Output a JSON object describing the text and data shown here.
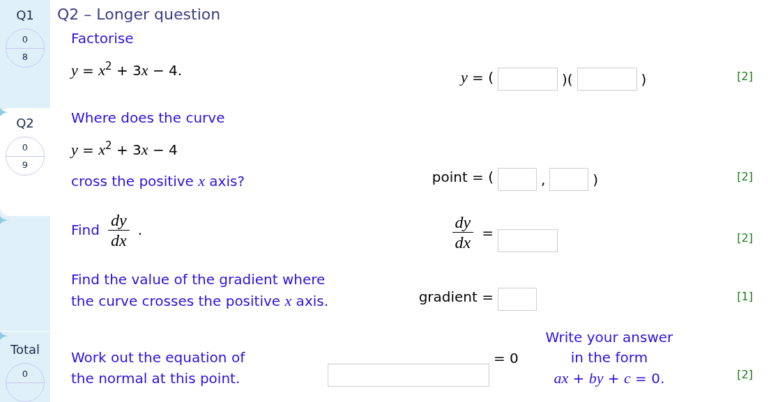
{
  "sidebar": {
    "items": [
      {
        "label": "Q1",
        "score": "0",
        "max": "8",
        "selected": false
      },
      {
        "label": "Q2",
        "score": "0",
        "max": "9",
        "selected": true
      }
    ],
    "total": {
      "label": "Total",
      "score": "0"
    }
  },
  "question": {
    "title": "Q2 – Longer question",
    "parts": [
      {
        "prompt": [
          [
            {
              "kind": "text",
              "text": "Factorise"
            }
          ],
          [
            {
              "kind": "math",
              "segments": [
                "*y* = *x*$^{2}$ + 3",
                "*x* − 4."
              ]
            }
          ]
        ],
        "answer_lhs": [
          {
            "kind": "math",
            "text": "*y* = ("
          }
        ],
        "answer_rhs": [
          {
            "kind": "field"
          },
          {
            "kind": "math",
            "text": ")("
          },
          {
            "kind": "field"
          },
          {
            "kind": "math",
            "text": ")"
          }
        ],
        "marks": "[2]"
      },
      {
        "prompt": [
          [
            {
              "kind": "text",
              "text": "Where does the curve"
            }
          ],
          [
            {
              "kind": "math",
              "segments": [
                "*y* = *x*$^{2}$ + 3",
                "*x* − 4"
              ]
            }
          ],
          [
            {
              "kind": "text",
              "text": "cross the positive *x* axis?"
            }
          ]
        ],
        "answer_lhs": [
          {
            "kind": "math",
            "text": "point = ("
          }
        ],
        "answer_rhs": [
          {
            "kind": "short_field"
          },
          {
            "kind": "math",
            "text": ","
          },
          {
            "kind": "short_field"
          },
          {
            "kind": "math",
            "text": ")"
          }
        ],
        "marks": "[2]"
      },
      {
        "prompt": [
          [
            {
              "kind": "text",
              "text": "Find"
            },
            {
              "kind": "frac",
              "num": "dy",
              "den": "dx"
            },
            {
              "kind": "math",
              "text": "."
            }
          ]
        ],
        "answer_lhs": [
          {
            "kind": "frac",
            "num": "dy",
            "den": "dx"
          },
          {
            "kind": "math",
            "text": "="
          }
        ],
        "answer_rhs": [
          {
            "kind": "field"
          }
        ],
        "marks": "[2]"
      },
      {
        "prompt": [
          [
            {
              "kind": "text",
              "text": "Find the value of the gradient where"
            }
          ],
          [
            {
              "kind": "text",
              "text": "the curve crosses the positive *x* axis."
            }
          ]
        ],
        "answer_lhs": [
          {
            "kind": "math",
            "text": "gradient ="
          }
        ],
        "answer_rhs": [
          {
            "kind": "short_field"
          }
        ],
        "marks": "[1]"
      },
      {
        "prompt": [
          [
            {
              "kind": "text",
              "text": "Work out the equation of"
            }
          ],
          [
            {
              "kind": "text",
              "text": "the normal at this point."
            }
          ]
        ],
        "answer_lhs": [
          {
            "kind": "long_field"
          }
        ],
        "answer_rhs": [
          {
            "kind": "math",
            "text": "= 0"
          }
        ],
        "hint": [
          "Write your answer",
          "in the form",
          "*ax* + *by* + *c* = 0."
        ],
        "marks": "[2]"
      }
    ]
  }
}
